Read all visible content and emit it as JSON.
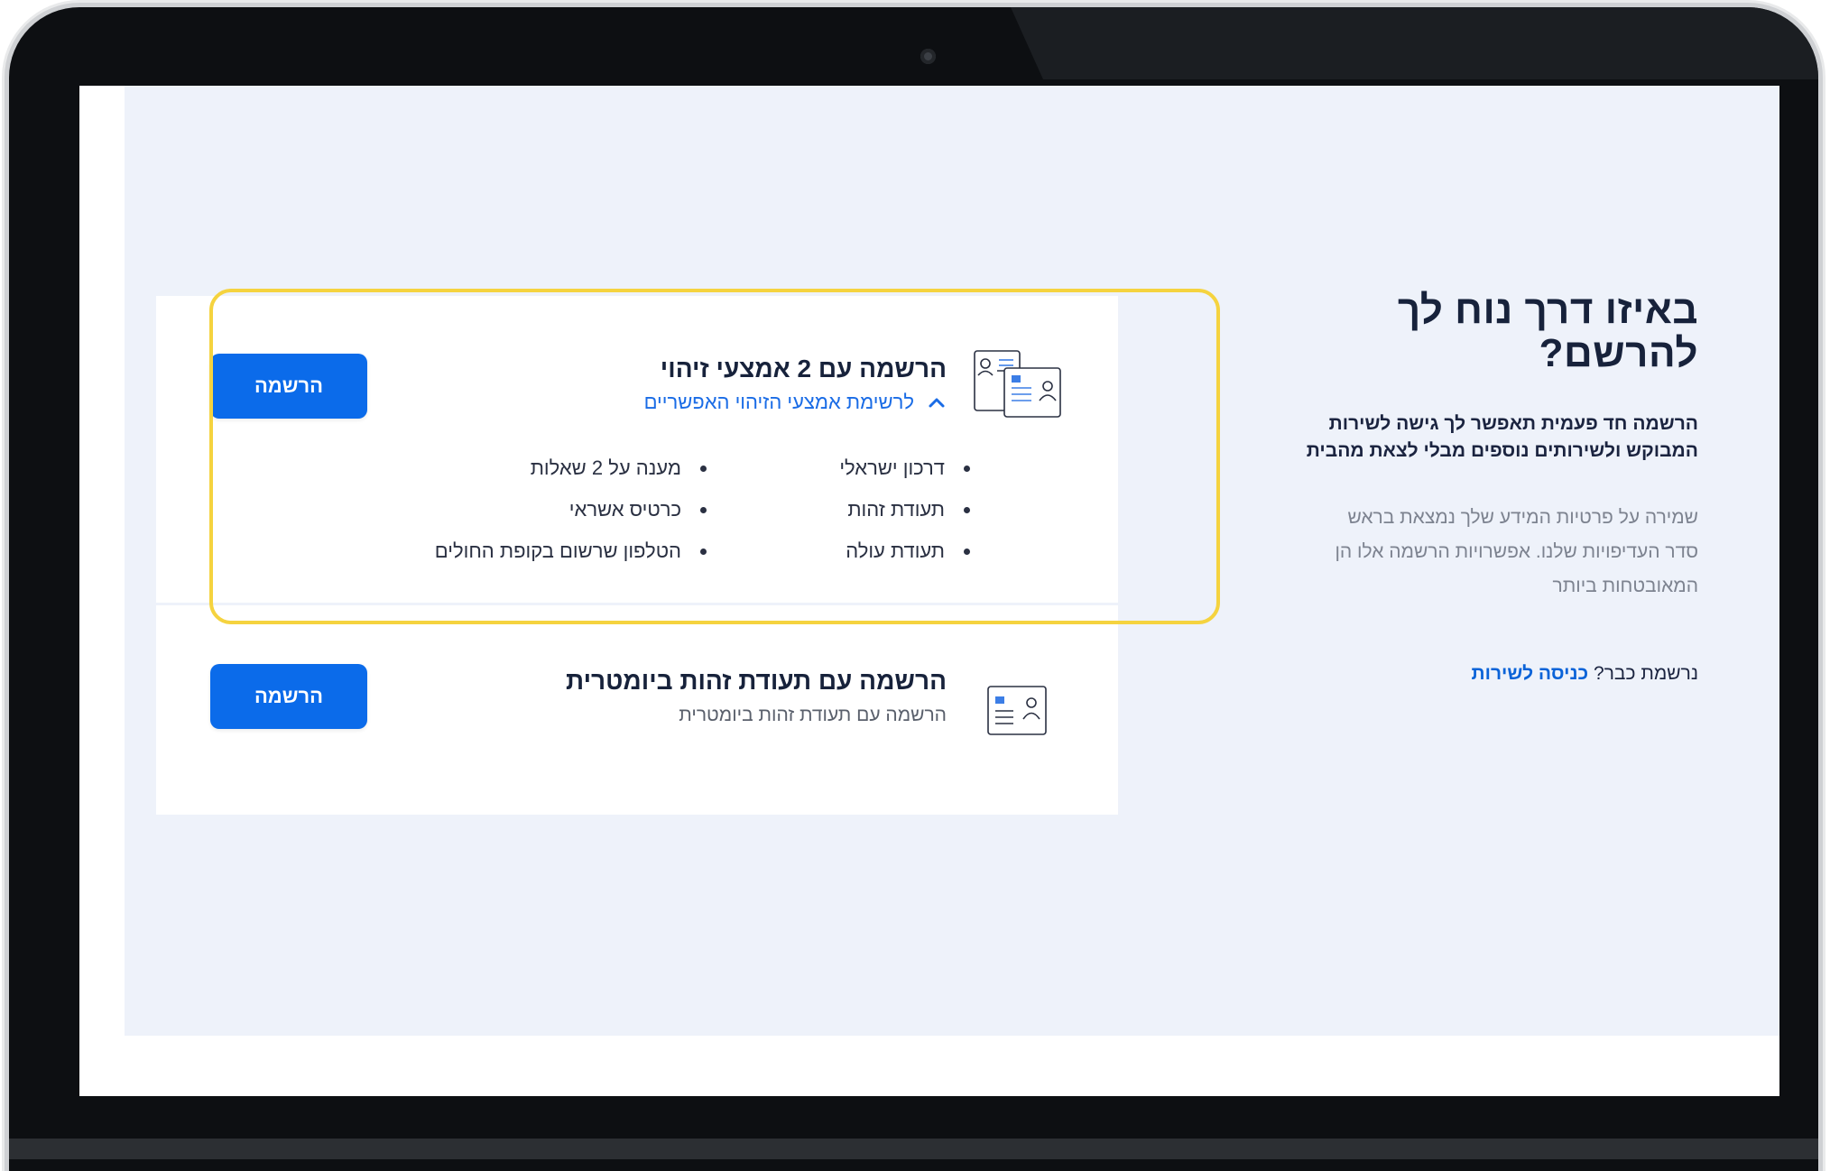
{
  "intro": {
    "title": "באיזו דרך נוח לך להרשם?",
    "lead_line1": "הרשמה חד פעמית תאפשר לך גישה לשירות",
    "lead_line2": "המבוקש ולשירותים נוספים מבלי לצאת מהבית",
    "sub_line1": "שמירה על פרטיות המידע שלך נמצאת בראש",
    "sub_line2": "סדר העדיפויות שלנו. אפשרויות הרשמה אלו הן",
    "sub_line3": "המאובטחות ביותר",
    "already_text": "נרשמת כבר?",
    "login_link": "כניסה לשירות"
  },
  "cards": [
    {
      "title": "הרשמה עם 2 אמצעי זיהוי",
      "toggle_label": "לרשימת אמצעי הזיהוי האפשריים",
      "button_label": "הרשמה",
      "icon": "id-documents-icon",
      "list_col1": [
        "דרכון ישראלי",
        "תעודת זהות",
        "תעודת עולה"
      ],
      "list_col2": [
        "מענה על 2 שאלות",
        "כרטיס אשראי",
        "הטלפון שרשום בקופת החולים"
      ]
    },
    {
      "title": "הרשמה עם תעודת זהות ביומטרית",
      "subtitle": "הרשמה עם תעודת זהות ביומטרית",
      "button_label": "הרשמה",
      "icon": "biometric-id-card-icon"
    }
  ],
  "colors": {
    "primary": "#0b6bea",
    "highlight": "#f5d33f",
    "page_bg": "#eef2fa",
    "heading": "#17223b"
  }
}
